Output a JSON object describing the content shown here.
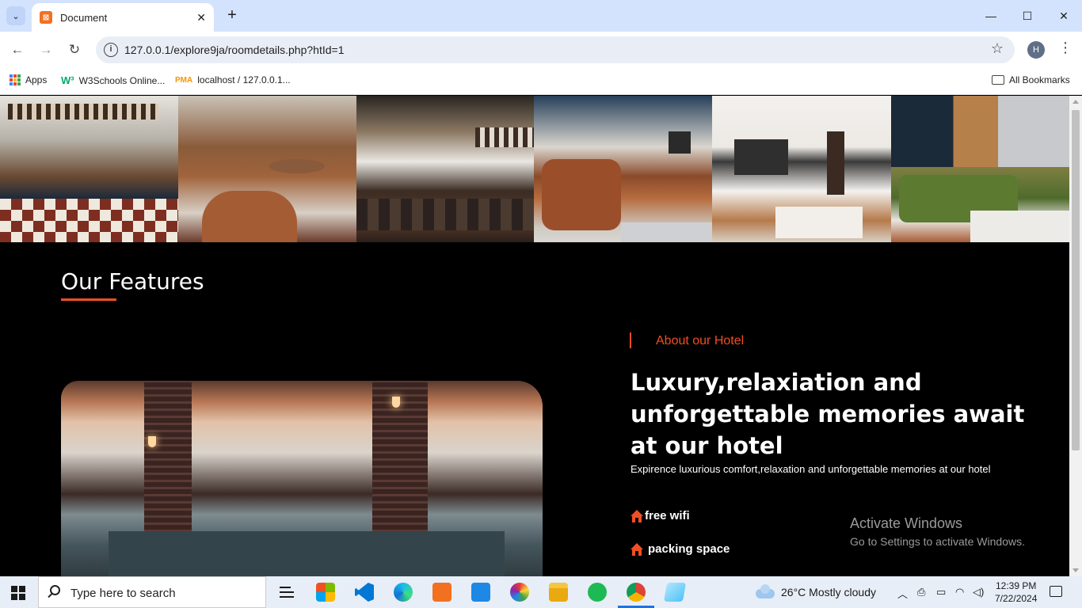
{
  "browser": {
    "tab_title": "Document",
    "url": "127.0.0.1/explore9ja/roomdetails.php?htId=1",
    "profile_initial": "H",
    "bookmarks": [
      {
        "label": "Apps"
      },
      {
        "label": "W3Schools Online..."
      },
      {
        "label": "localhost / 127.0.0.1..."
      }
    ],
    "all_bookmarks": "All Bookmarks"
  },
  "page": {
    "features_title": "Our Features",
    "about_label": "About our Hotel",
    "headline": "Luxury,relaxiation and unforgettable memories await at our hotel",
    "subtext": "Expirence luxurious comfort,relaxation and unforgettable memories at our hotel",
    "features": [
      "free wifi",
      "packing space"
    ],
    "accent_color": "#f04e23"
  },
  "watermark": {
    "line1": "Activate Windows",
    "line2": "Go to Settings to activate Windows."
  },
  "taskbar": {
    "search_placeholder": "Type here to search",
    "weather": "26°C  Mostly cloudy",
    "time": "12:39 PM",
    "date": "7/22/2024"
  }
}
